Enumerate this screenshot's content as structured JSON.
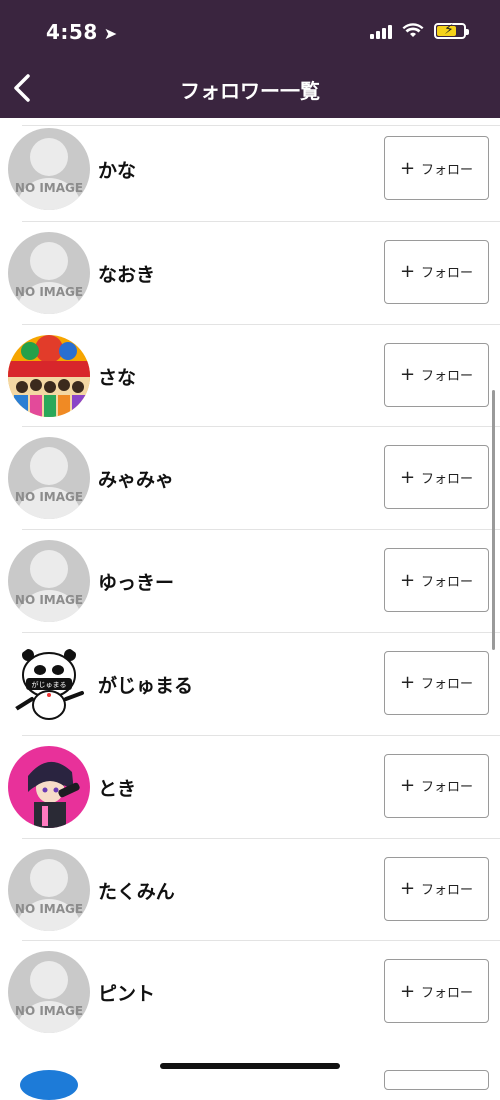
{
  "status": {
    "time": "4:58"
  },
  "header": {
    "title": "フォロワー一覧"
  },
  "no_image_text": "NO IMAGE",
  "follow_label": "フォロー",
  "users": [
    {
      "name": "かな",
      "avatar": "no-image"
    },
    {
      "name": "なおき",
      "avatar": "no-image"
    },
    {
      "name": "さな",
      "avatar": "photo"
    },
    {
      "name": "みゃみゃ",
      "avatar": "no-image"
    },
    {
      "name": "ゆっきー",
      "avatar": "no-image"
    },
    {
      "name": "がじゅまる",
      "avatar": "panda-illustration"
    },
    {
      "name": "とき",
      "avatar": "anime-illustration"
    },
    {
      "name": "たくみん",
      "avatar": "no-image"
    },
    {
      "name": "ピント",
      "avatar": "no-image"
    }
  ],
  "avatar_art": {
    "panda_text": "がじゅまる"
  }
}
